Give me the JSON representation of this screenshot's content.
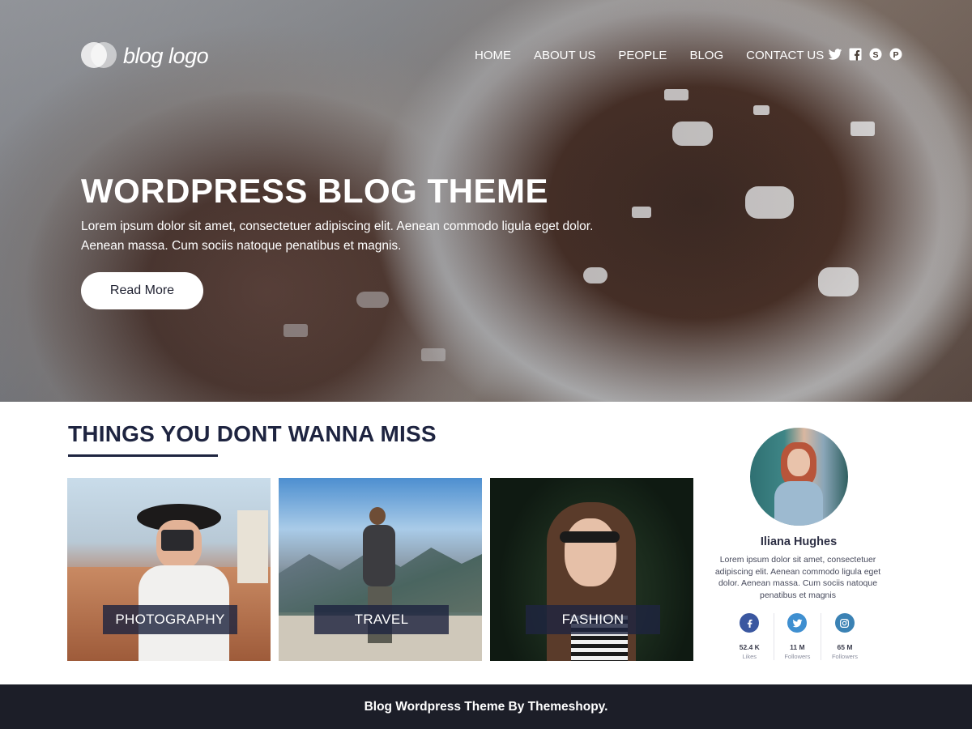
{
  "header": {
    "logo_text": "blog logo",
    "nav": [
      "HOME",
      "ABOUT US",
      "PEOPLE",
      "BLOG",
      "CONTACT US"
    ],
    "social_icons": [
      "twitter-icon",
      "facebook-icon",
      "skype-icon",
      "pinterest-icon"
    ]
  },
  "hero": {
    "title": "WORDPRESS BLOG THEME",
    "text": "Lorem ipsum dolor sit amet, consectetuer adipiscing elit. Aenean commodo ligula eget dolor. Aenean massa. Cum sociis natoque penatibus et magnis.",
    "button_label": "Read More"
  },
  "section": {
    "title": "THINGS YOU DONT WANNA MISS",
    "cards": [
      {
        "label": "PHOTOGRAPHY"
      },
      {
        "label": "TRAVEL"
      },
      {
        "label": "FASHION"
      }
    ]
  },
  "profile": {
    "name": "Iliana Hughes",
    "text": "Lorem ipsum dolor sit amet, consectetuer adipiscing elit. Aenean commodo ligula eget dolor. Aenean massa. Cum sociis natoque penatibus et magnis",
    "stats": [
      {
        "icon": "facebook-icon",
        "count": "52.4 K",
        "label": "Likes"
      },
      {
        "icon": "twitter-icon",
        "count": "11 M",
        "label": "Followers"
      },
      {
        "icon": "instagram-icon",
        "count": "65 M",
        "label": "Followers"
      }
    ]
  },
  "footer": {
    "text": "Blog Wordpress Theme By Themeshopy."
  },
  "colors": {
    "navy": "#1e2440",
    "footer_bg": "#1c1e28",
    "facebook": "#3a57a0",
    "twitter": "#3f8fd0",
    "instagram": "#3b82b4"
  }
}
